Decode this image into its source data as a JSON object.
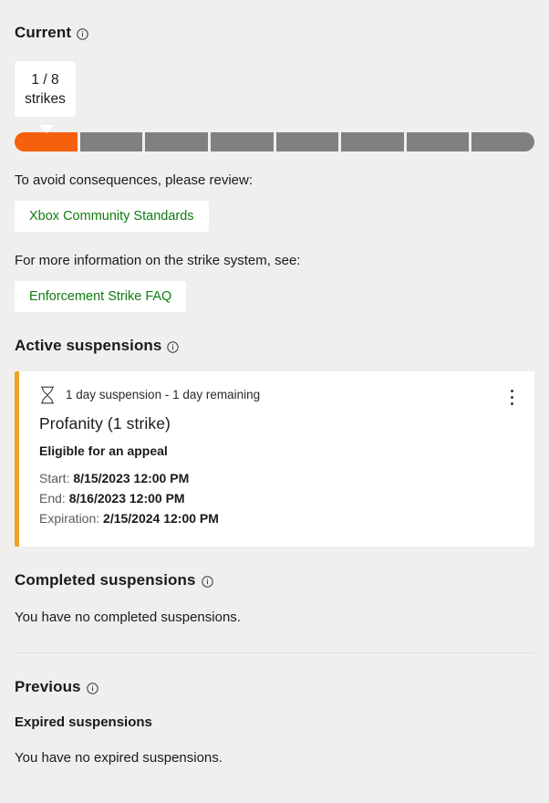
{
  "colors": {
    "background": "#f0efee",
    "strike_filled": "#f4600b",
    "strike_empty": "#808080",
    "card_accent": "#f2a128",
    "link_green": "#107c10",
    "text": "#1b1a19"
  },
  "current": {
    "heading": "Current",
    "info_icon": "info-circle-icon",
    "callout": {
      "line1": "1 / 8",
      "line2": "strikes"
    },
    "strikes": {
      "used": 1,
      "total": 8,
      "segments": [
        true,
        false,
        false,
        false,
        false,
        false,
        false,
        false
      ]
    },
    "review_prompt": "To avoid consequences, please review:",
    "review_link": "Xbox Community Standards",
    "info_prompt": "For more information on the strike system, see:",
    "info_link": "Enforcement Strike FAQ"
  },
  "active_suspensions": {
    "heading": "Active suspensions",
    "info_icon": "info-circle-icon",
    "card": {
      "status_icon": "hourglass-icon",
      "duration_text": "1 day suspension - 1 day remaining",
      "title": "Profanity (1 strike)",
      "appeal_status": "Eligible for an appeal",
      "menu_icon": "more-vertical-icon",
      "details": [
        {
          "label": "Start:",
          "value": "8/15/2023 12:00 PM"
        },
        {
          "label": "End:",
          "value": "8/16/2023 12:00 PM"
        },
        {
          "label": "Expiration:",
          "value": "2/15/2024 12:00 PM"
        }
      ]
    }
  },
  "completed_suspensions": {
    "heading": "Completed suspensions",
    "info_icon": "info-circle-icon",
    "empty_text": "You have no completed suspensions."
  },
  "previous": {
    "heading": "Previous",
    "info_icon": "info-circle-icon",
    "expired_heading": "Expired suspensions",
    "empty_text": "You have no expired suspensions."
  }
}
